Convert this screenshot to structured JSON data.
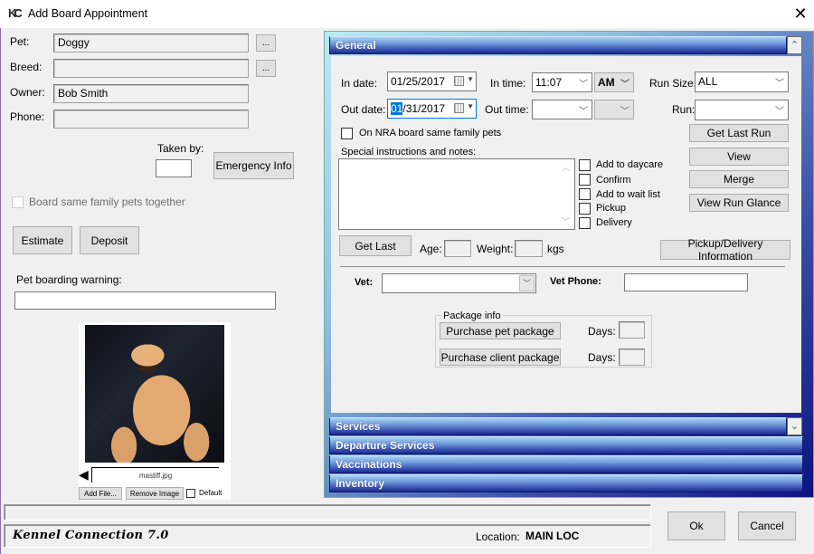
{
  "window": {
    "title": "Add Board Appointment",
    "icon": "kc-logo-icon",
    "close_glyph": "✕"
  },
  "left": {
    "pet_label": "Pet:",
    "pet_value": "Doggy",
    "breed_label": "Breed:",
    "breed_value": "",
    "owner_label": "Owner:",
    "owner_value": "Bob Smith",
    "phone_label": "Phone:",
    "phone_value": "",
    "browse_label": "...",
    "taken_by_label": "Taken by:",
    "taken_by_value": "",
    "emergency_info_label": "Emergency Info",
    "board_family_label": "Board same family pets together",
    "board_family_checked": false,
    "estimate_label": "Estimate",
    "deposit_label": "Deposit",
    "warning_label": "Pet boarding warning:",
    "warning_value": "",
    "image": {
      "filename": "mastiff.jpg",
      "add_file_label": "Add File...",
      "remove_image_label": "Remove Image",
      "default_label": "Default",
      "default_checked": false,
      "prev_glyph": "◀"
    }
  },
  "general": {
    "header": "General",
    "collapse_glyph": "⌃",
    "in_date_label": "In date:",
    "in_date_value": "01/25/2017",
    "out_date_label": "Out date:",
    "out_date_selected": "01",
    "out_date_rest": "/31/2017",
    "in_time_label": "In time:",
    "in_time_value": "11:07",
    "in_ampm_value": "AM",
    "out_time_label": "Out time:",
    "out_time_value": "",
    "out_ampm_value": "",
    "run_size_label": "Run Size:",
    "run_size_value": "ALL",
    "run_label": "Run:",
    "run_value": "",
    "nra_label": "On NRA board same family pets",
    "nra_checked": false,
    "notes_label": "Special instructions and notes:",
    "notes_value": "",
    "options": [
      {
        "label": "Add to daycare",
        "checked": false
      },
      {
        "label": "Confirm",
        "checked": false
      },
      {
        "label": "Add to wait list",
        "checked": false
      },
      {
        "label": "Pickup",
        "checked": false
      },
      {
        "label": "Delivery",
        "checked": false
      }
    ],
    "buttons": {
      "get_last_run": "Get Last Run",
      "view": "View",
      "merge": "Merge",
      "view_run_glance": "View Run Glance",
      "get_last": "Get Last",
      "pickup_delivery_info": "Pickup/Delivery Information"
    },
    "age_label": "Age:",
    "age_value": "",
    "weight_label": "Weight:",
    "weight_value": "",
    "weight_unit": "kgs",
    "vet_label": "Vet:",
    "vet_value": "",
    "vet_phone_label": "Vet Phone:",
    "vet_phone_value": "",
    "package": {
      "legend": "Package info",
      "pet_package_label": "Purchase pet package",
      "client_package_label": "Purchase client package",
      "days_label": "Days:",
      "pet_days_value": "",
      "client_days_value": ""
    }
  },
  "sections": [
    {
      "label": "Services",
      "expand_glyph": "⌄"
    },
    {
      "label": "Departure Services"
    },
    {
      "label": "Vaccinations"
    },
    {
      "label": "Inventory"
    }
  ],
  "footer": {
    "brand": "Kennel Connection 7.0",
    "location_label": "Location:",
    "location_value": "MAIN LOC",
    "ok_label": "Ok",
    "cancel_label": "Cancel"
  }
}
